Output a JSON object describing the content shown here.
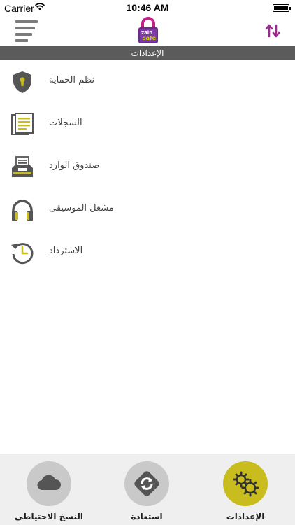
{
  "status_bar": {
    "carrier": "Carrier",
    "time": "10:46 AM"
  },
  "nav": {
    "logo_text_top": "zain",
    "logo_text_bottom": "safe",
    "menu_icon": "hamburger-menu-icon",
    "sort_icon": "sort-arrows-icon"
  },
  "section_header": {
    "title": "الإعدادات"
  },
  "menu": {
    "items": [
      {
        "label": "نظم الحماية",
        "icon": "shield-lock-icon"
      },
      {
        "label": "السجلات",
        "icon": "documents-icon"
      },
      {
        "label": "صندوق الوارد",
        "icon": "inbox-tray-icon"
      },
      {
        "label": "مشغل الموسيقى",
        "icon": "headphones-icon"
      },
      {
        "label": "الاسترداد",
        "icon": "history-clock-icon"
      }
    ]
  },
  "tabs": {
    "backup_label": "النسخ الاحتياطي",
    "restore_label": "استعادة",
    "settings_label": "الإعدادات",
    "active": "settings"
  },
  "colors": {
    "accent_yellow": "#c8bc1e",
    "accent_purple": "#9b2a8f",
    "header_gray": "#5b5b5b",
    "icon_gray": "#666666"
  }
}
